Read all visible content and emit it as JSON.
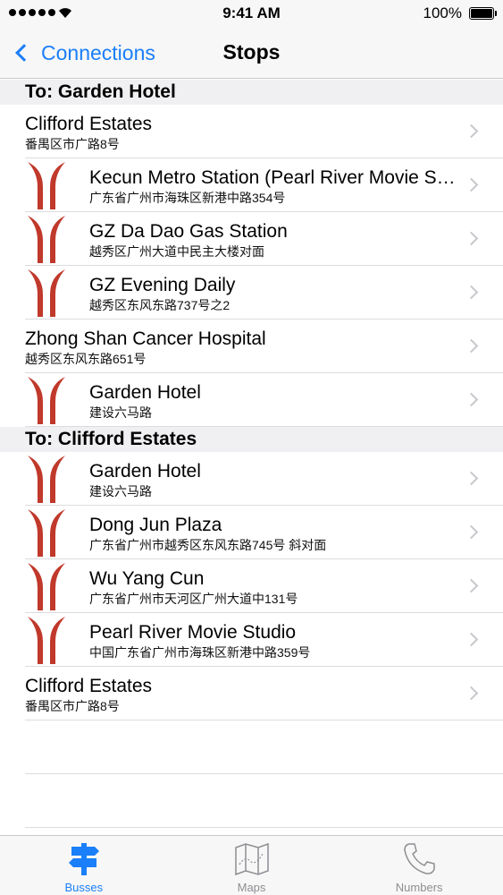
{
  "status_bar": {
    "time": "9:41 AM",
    "battery": "100%"
  },
  "nav": {
    "back_label": "Connections",
    "title": "Stops"
  },
  "sections": [
    {
      "header": "To: Garden Hotel",
      "rows": [
        {
          "title": "Clifford Estates",
          "subtitle": "番禺区市广路8号",
          "metro": false
        },
        {
          "title": "Kecun Metro Station (Pearl River Movie Studio)",
          "subtitle": "广东省广州市海珠区新港中路354号",
          "metro": true
        },
        {
          "title": "GZ Da Dao Gas Station",
          "subtitle": "越秀区广州大道中民主大楼对面",
          "metro": true
        },
        {
          "title": "GZ Evening Daily",
          "subtitle": "越秀区东风东路737号之2",
          "metro": true
        },
        {
          "title": "Zhong Shan Cancer Hospital",
          "subtitle": "越秀区东风东路651号",
          "metro": false
        },
        {
          "title": "Garden Hotel",
          "subtitle": "建设六马路",
          "metro": true
        }
      ]
    },
    {
      "header": "To: Clifford Estates",
      "rows": [
        {
          "title": "Garden Hotel",
          "subtitle": "建设六马路",
          "metro": true
        },
        {
          "title": "Dong Jun Plaza",
          "subtitle": "广东省广州市越秀区东风东路745号 斜对面",
          "metro": true
        },
        {
          "title": "Wu Yang Cun",
          "subtitle": "广东省广州市天河区广州大道中131号",
          "metro": true
        },
        {
          "title": "Pearl River Movie Studio",
          "subtitle": "中国广东省广州市海珠区新港中路359号",
          "metro": true
        },
        {
          "title": "Clifford Estates",
          "subtitle": "番禺区市广路8号",
          "metro": false
        }
      ]
    }
  ],
  "tabs": [
    {
      "label": "Busses",
      "icon": "signpost-icon",
      "active": true
    },
    {
      "label": "Maps",
      "icon": "map-icon",
      "active": false
    },
    {
      "label": "Numbers",
      "icon": "phone-icon",
      "active": false
    }
  ],
  "colors": {
    "accent": "#1a7ff8",
    "metro_logo": "#c0392b"
  }
}
